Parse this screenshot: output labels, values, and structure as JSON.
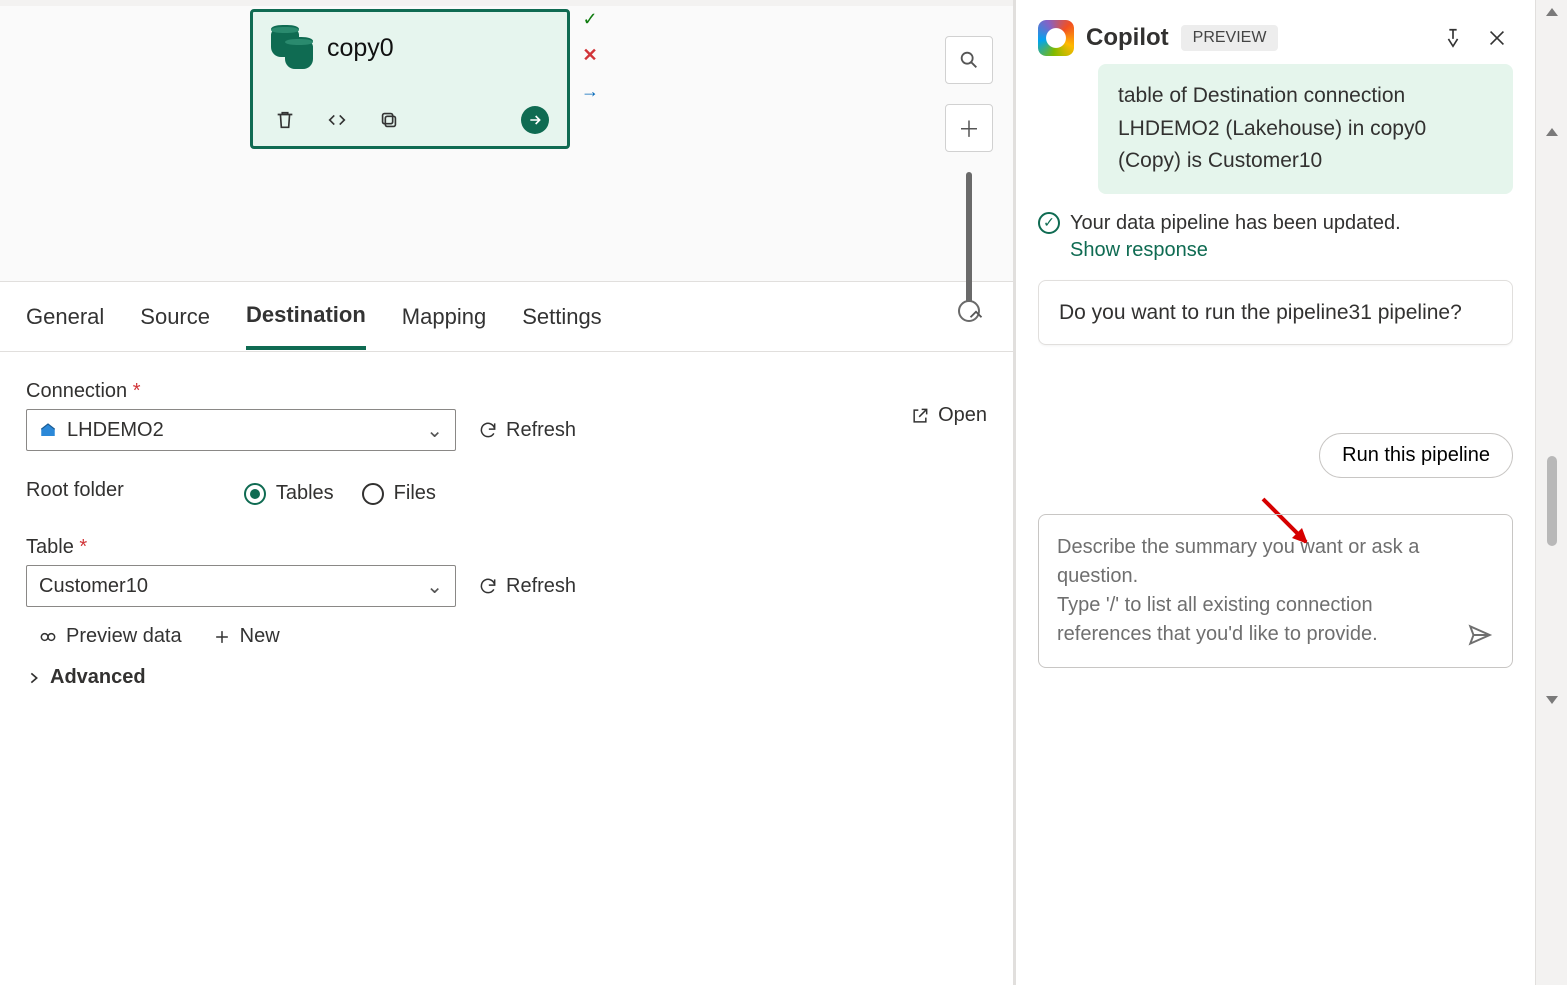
{
  "canvas": {
    "activity": {
      "name": "copy0"
    }
  },
  "tabs": {
    "general": "General",
    "source": "Source",
    "destination": "Destination",
    "mapping": "Mapping",
    "settings": "Settings"
  },
  "destination": {
    "connection_label": "Connection",
    "connection_value": "LHDEMO2",
    "open_label": "Open",
    "refresh_label": "Refresh",
    "root_folder_label": "Root folder",
    "root_folder_options": {
      "tables": "Tables",
      "files": "Files"
    },
    "root_folder_selected": "tables",
    "table_label": "Table",
    "table_value": "Customer10",
    "preview_label": "Preview data",
    "new_label": "New",
    "advanced_label": "Advanced"
  },
  "copilot": {
    "title": "Copilot",
    "badge": "PREVIEW",
    "green_bubble": "table of Destination connection LHDEMO2 (Lakehouse) in copy0 (Copy) is Customer10",
    "status_msg": "Your data pipeline has been updated.",
    "show_response": "Show response",
    "prompt_bubble": "Do you want to run the pipeline31 pipeline?",
    "suggest_button": "Run this pipeline",
    "input_placeholder": "Describe the summary you want or ask a question.\nType '/' to list all existing connection references that you'd like to provide."
  }
}
